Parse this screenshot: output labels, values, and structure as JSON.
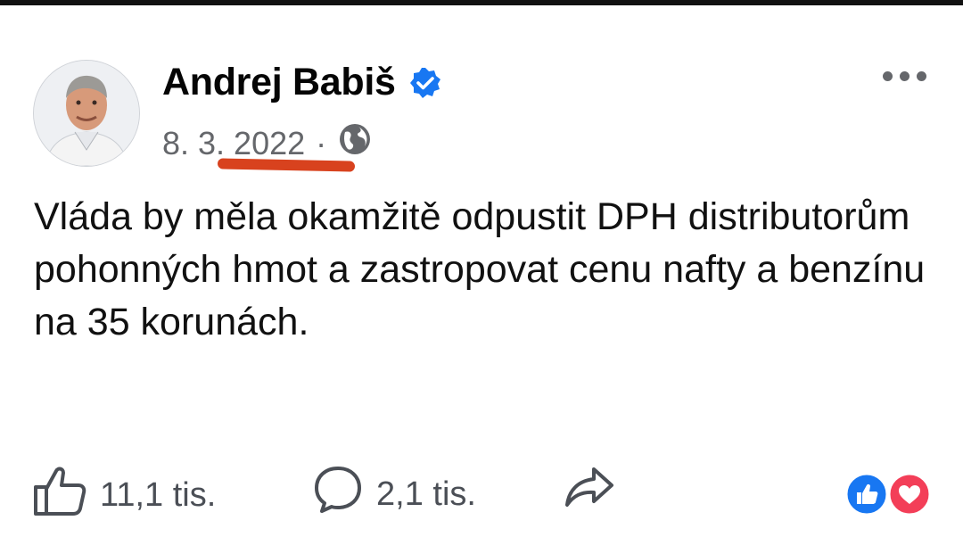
{
  "post": {
    "author": "Andrej Babiš",
    "date": "8. 3. 2022",
    "separator": "·",
    "text": "Vláda by měla okamžitě odpustit DPH distributorům pohonných hmot a zastropovat cenu nafty a benzínu na 35 korunách."
  },
  "actions": {
    "likes": "11,1 tis.",
    "comments": "2,1 tis."
  },
  "icons": [
    "verified-badge-icon",
    "globe-icon",
    "more-options-icon",
    "thumbs-up-icon",
    "comment-bubble-icon",
    "share-arrow-icon",
    "like-reaction-icon",
    "love-reaction-icon"
  ],
  "colors": {
    "verified": "#1877f2",
    "underline": "#d8421e",
    "like_reaction": "#1877f2",
    "love_reaction": "#f33e58"
  }
}
